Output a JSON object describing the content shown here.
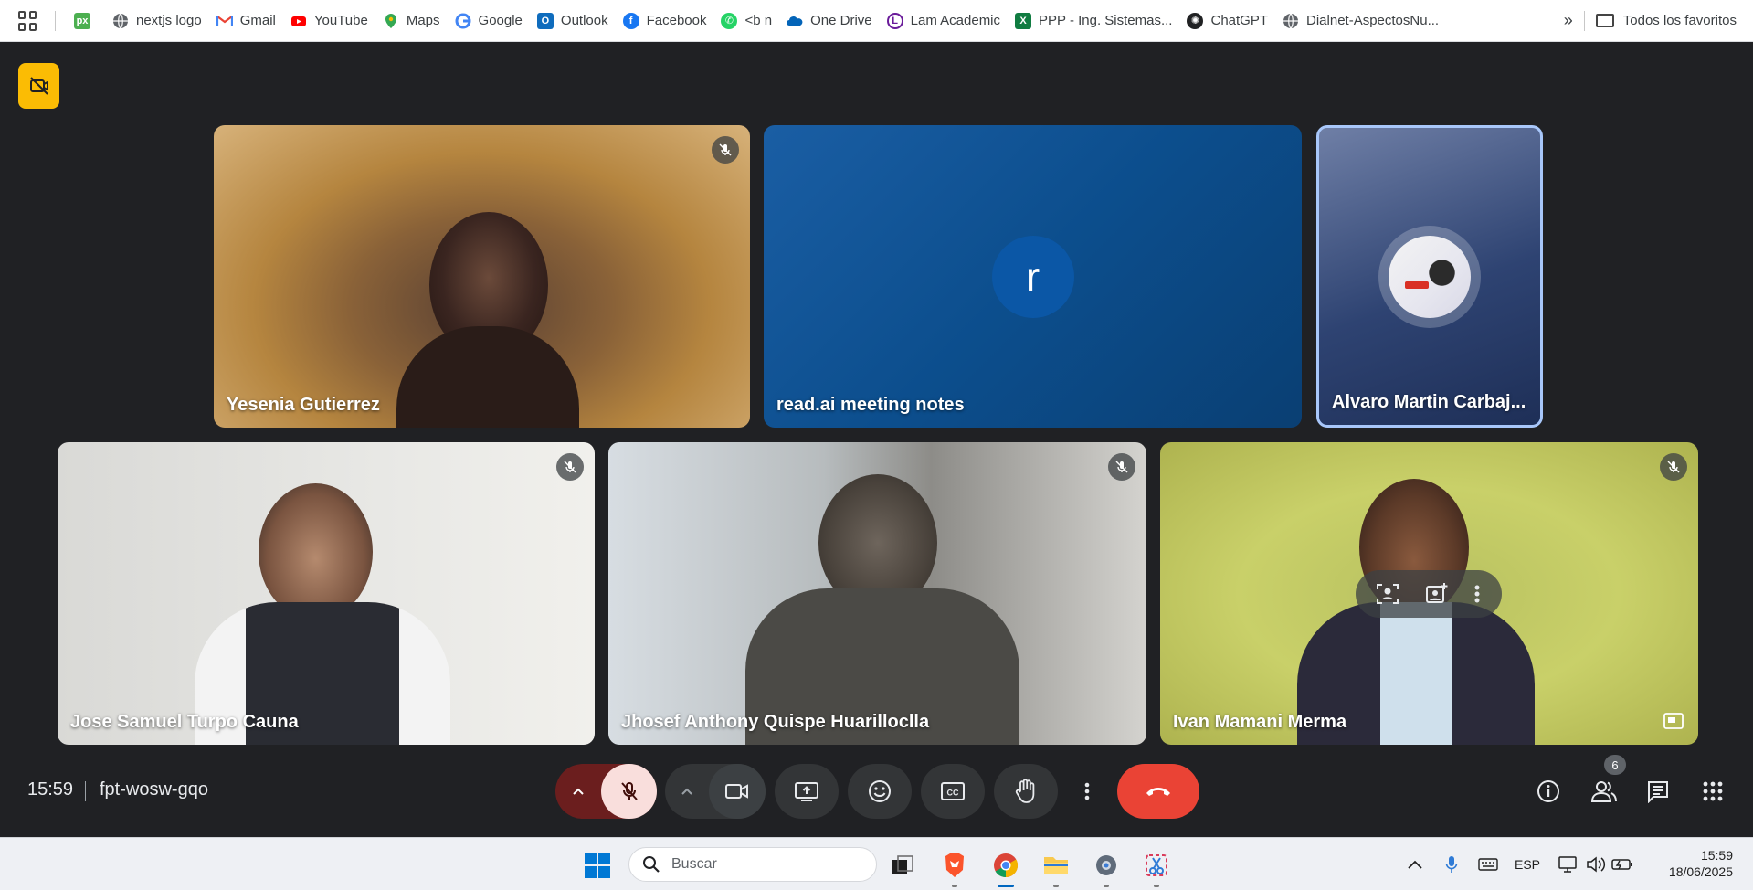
{
  "bookmarks": {
    "items": [
      {
        "label": "",
        "icon": "px-icon",
        "color": "#4caf50"
      },
      {
        "label": "nextjs logo",
        "icon": "globe-icon",
        "color": "#5f6368"
      },
      {
        "label": "Gmail",
        "icon": "gmail-icon",
        "color": "#ea4335"
      },
      {
        "label": "YouTube",
        "icon": "youtube-icon",
        "color": "#ff0000"
      },
      {
        "label": "Maps",
        "icon": "maps-icon",
        "color": "#34a853"
      },
      {
        "label": "Google",
        "icon": "google-icon",
        "color": "#4285f4"
      },
      {
        "label": "Outlook",
        "icon": "outlook-icon",
        "color": "#0f6cbd"
      },
      {
        "label": "Facebook",
        "icon": "facebook-icon",
        "color": "#1877f2"
      },
      {
        "label": "<b n",
        "icon": "whatsapp-icon",
        "color": "#25d366"
      },
      {
        "label": "One Drive",
        "icon": "onedrive-icon",
        "color": "#0364b8"
      },
      {
        "label": "Lam Academic",
        "icon": "lam-icon",
        "color": "#6a1b9a"
      },
      {
        "label": "PPP - Ing. Sistemas...",
        "icon": "excel-icon",
        "color": "#107c41"
      },
      {
        "label": "ChatGPT",
        "icon": "chatgpt-icon",
        "color": "#202123"
      },
      {
        "label": "Dialnet-AspectosNu...",
        "icon": "globe-icon",
        "color": "#5f6368"
      }
    ],
    "more": "»",
    "all_favorites": "Todos los favoritos"
  },
  "tiles": [
    {
      "name": "Yesenia Gutierrez",
      "muted": true
    },
    {
      "name": "read.ai meeting notes",
      "avatar_letter": "r"
    },
    {
      "name": "Alvaro Martin Carbaj..."
    },
    {
      "name": "Jose Samuel Turpo Cauna",
      "muted": true
    },
    {
      "name": "Jhosef Anthony Quispe Huarilloclla",
      "muted": true
    },
    {
      "name": "Ivan Mamani Merma",
      "muted": true
    }
  ],
  "meeting": {
    "time": "15:59",
    "code": "fpt-wosw-gqo",
    "participant_count": "6"
  },
  "taskbar": {
    "search_placeholder": "Buscar",
    "language": "ESP",
    "time": "15:59",
    "date": "18/06/2025"
  },
  "colors": {
    "meet_bg": "#202124",
    "end_call": "#ea4335",
    "mic_muted_bg": "#f9dedc",
    "cam_off_badge": "#fbbc04",
    "active_speaker_border": "#a8c7fa"
  }
}
